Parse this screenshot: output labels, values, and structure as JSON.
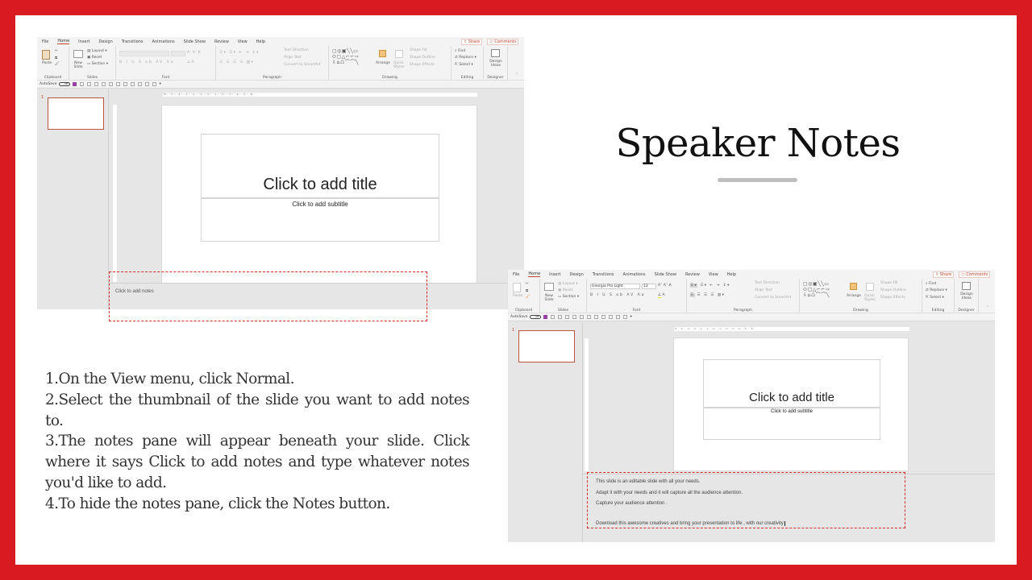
{
  "slide": {
    "heading": "Speaker Notes",
    "steps": [
      "1.On the View menu, click Normal.",
      "2.Select the thumbnail of the slide you want to add notes to.",
      "3.The notes pane will appear beneath your slide. Click where it says Click to add notes and type whatever notes you'd like to add.",
      "4.To hide the notes pane, click the Notes button."
    ],
    "colors": {
      "frame": "#da1a21",
      "accent": "#c4452b",
      "highlight_dash": "#d42a2a"
    }
  },
  "ppt": {
    "menu": [
      "File",
      "Home",
      "Insert",
      "Design",
      "Transitions",
      "Animations",
      "Slide Show",
      "Review",
      "View",
      "Help"
    ],
    "active_menu": "Home",
    "share": "Share",
    "comments": "Comments",
    "groups": {
      "clipboard": "Clipboard",
      "slides": "Slides",
      "font": "Font",
      "paragraph": "Paragraph",
      "drawing": "Drawing",
      "editing": "Editing",
      "designer": "Designer"
    },
    "buttons": {
      "paste": "Paste",
      "new_slide": "New Slide",
      "layout": "Layout",
      "reset": "Reset",
      "section": "Section",
      "text_direction": "Text Direction",
      "align_text": "Align Text",
      "convert_smartart": "Convert to SmartArt",
      "arrange": "Arrange",
      "quick_styles": "Quick Styles",
      "shape_fill": "Shape Fill",
      "shape_outline": "Shape Outline",
      "shape_effects": "Shape Effects",
      "find": "Find",
      "replace": "Replace",
      "select": "Select",
      "design_ideas": "Design Ideas"
    },
    "autosave": "AutoSave",
    "autosave_state": "Off",
    "slide_number": "1",
    "ruler_h": "·6·····5·····4·····3·····2·····1·····0·····1·····2·····3·····4·····5·····6·",
    "title_placeholder": "Click to add title",
    "subtitle_placeholder": "Click to add subtitle"
  },
  "window1": {
    "font_name": "",
    "font_size": "",
    "notes_placeholder": "Click to add notes"
  },
  "window2": {
    "font_name": "Georgia Pro Light",
    "font_size": "12",
    "notes": [
      "This slide is an editable slide with all your needs.",
      "Adapt it with your needs and it will capture all the audience attention.",
      "Capture your audience attention .",
      "Download this awesome creatives and bring your presentation to life , with our creativity"
    ]
  }
}
